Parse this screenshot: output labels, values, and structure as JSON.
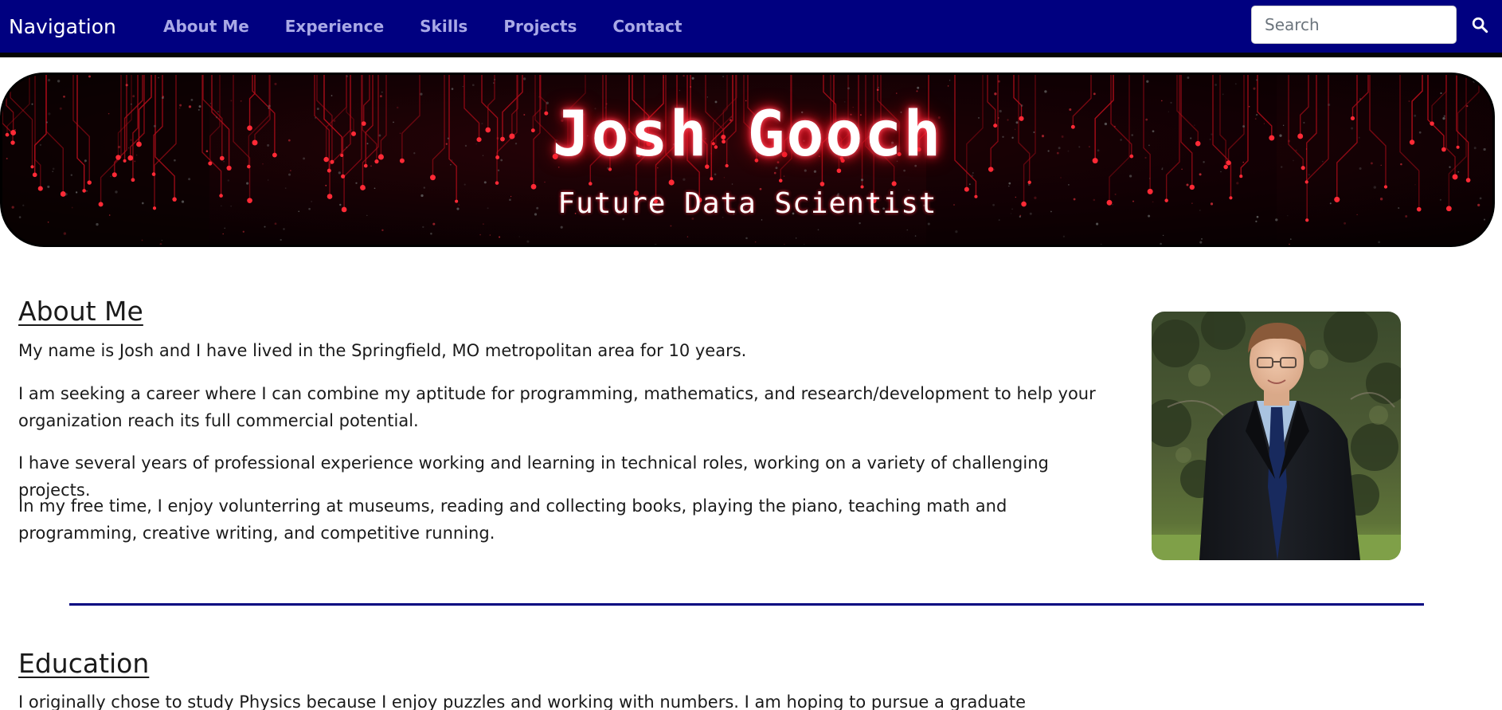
{
  "navbar": {
    "brand": "Navigation",
    "links": [
      {
        "label": "About Me"
      },
      {
        "label": "Experience"
      },
      {
        "label": "Skills"
      },
      {
        "label": "Projects"
      },
      {
        "label": "Contact"
      }
    ],
    "search": {
      "placeholder": "Search",
      "icon": "search-icon"
    },
    "background_color": "#000080",
    "link_color": "#a9a9e6"
  },
  "hero": {
    "title": "Josh Gooch",
    "subtitle": "Future Data Scientist",
    "glow_color": "#ff2233"
  },
  "about": {
    "heading": "About Me",
    "paragraphs": [
      "My name is Josh and I have lived in the Springfield, MO metropolitan area for 10 years.",
      "I am seeking a career where I can combine my aptitude for programming, mathematics, and research/development to help your organization reach its full commercial potential.",
      "I have several years of professional experience working and learning in technical roles, working on a variety of challenging projects.",
      "In my free time, I enjoy volunterring at museums, reading and collecting books, playing the piano, teaching math and programming, creative writing, and competitive running."
    ]
  },
  "education": {
    "heading": "Education",
    "paragraph": "I originally chose to study Physics because I enjoy puzzles and working with numbers. I am hoping to pursue a graduate"
  },
  "divider_color": "#000080"
}
